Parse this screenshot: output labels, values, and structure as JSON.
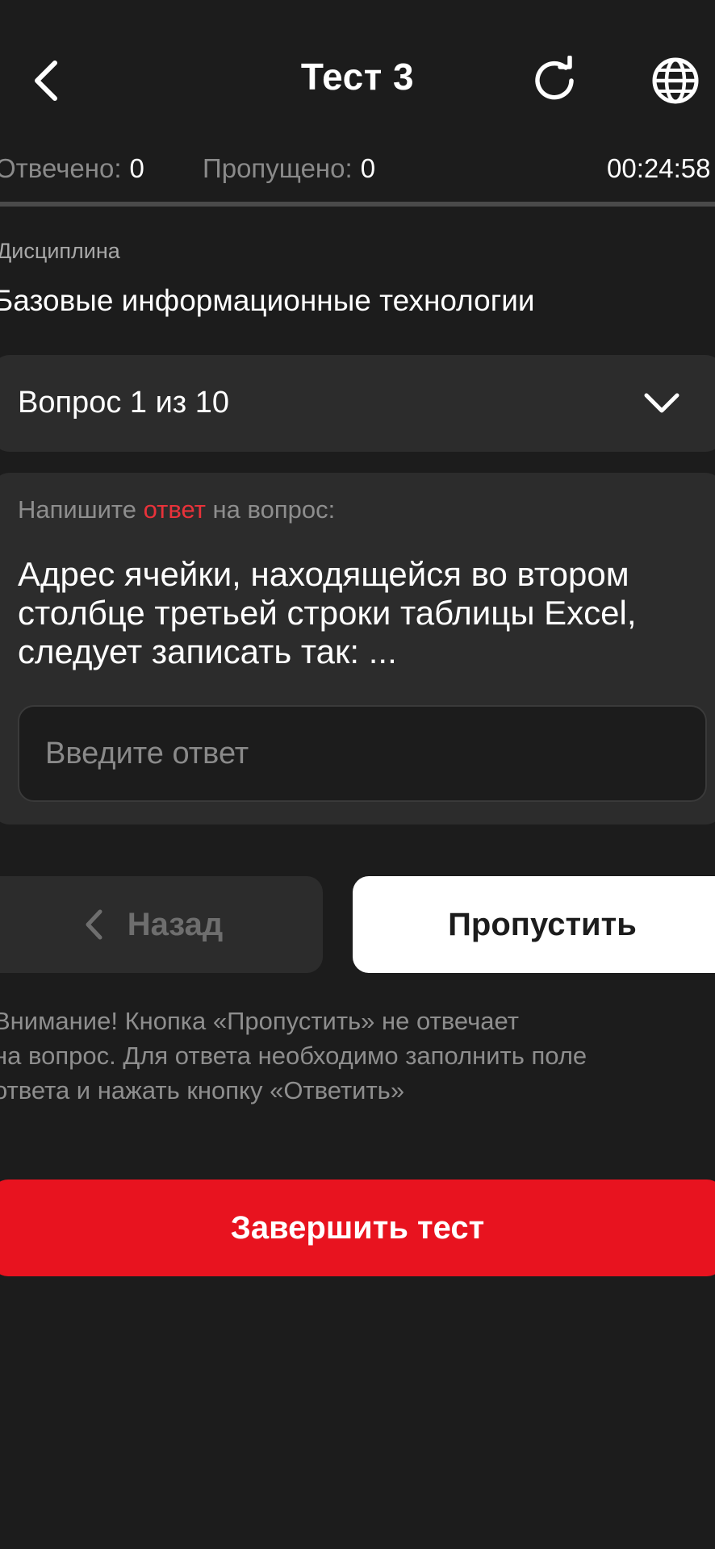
{
  "header": {
    "title": "Тест 3",
    "back_icon": "chevron-left-icon",
    "refresh_icon": "refresh-icon",
    "language_icon": "globe-icon"
  },
  "stats": {
    "answered_label": "Отвечено:",
    "answered_value": "0",
    "skipped_label": "Пропущено:",
    "skipped_value": "0",
    "timer": "00:24:58"
  },
  "discipline": {
    "label": "Дисциплина",
    "value": "Базовые информационные технологии"
  },
  "question_selector": {
    "label": "Вопрос 1 из 10"
  },
  "question": {
    "instruction_prefix": "Напишите ",
    "instruction_accent": "ответ",
    "instruction_suffix": " на вопрос:",
    "text": "Адрес ячейки, находящейся во втором столбце третьей строки таблицы Excel, следует записать так: ...",
    "answer_placeholder": "Введите ответ",
    "answer_value": ""
  },
  "actions": {
    "back_label": "Назад",
    "skip_label": "Пропустить",
    "finish_label": "Завершить тест"
  },
  "warning": {
    "line1": "Внимание! Кнопка «Пропустить» не отвечает",
    "line2": "на вопрос. Для ответа необходимо заполнить поле",
    "line3": "ответа и нажать кнопку «Ответить»"
  },
  "colors": {
    "background": "#1c1c1c",
    "card": "#2c2c2c",
    "accent_red": "#e8131f",
    "accent_text_red": "#e8323a",
    "muted_text": "#8e8e8e"
  }
}
